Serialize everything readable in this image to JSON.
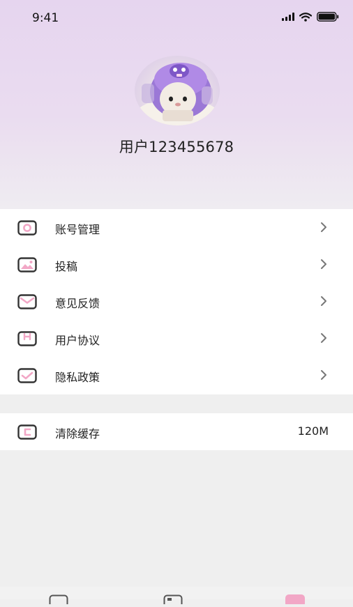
{
  "status_bar": {
    "time": "9:41"
  },
  "profile": {
    "username": "用户123455678"
  },
  "menu": {
    "items": [
      {
        "label": "账号管理",
        "icon": "account-icon"
      },
      {
        "label": "投稿",
        "icon": "image-icon"
      },
      {
        "label": "意见反馈",
        "icon": "envelope-icon"
      },
      {
        "label": "用户协议",
        "icon": "agreement-icon"
      },
      {
        "label": "隐私政策",
        "icon": "check-icon"
      }
    ]
  },
  "cache": {
    "label": "清除缓存",
    "value": "120M",
    "icon": "clear-cache-icon"
  },
  "tabbar": {
    "tabs": [
      {
        "icon": "home-icon"
      },
      {
        "icon": "category-icon"
      },
      {
        "icon": "profile-icon"
      }
    ]
  },
  "colors": {
    "accent_pink": "#f2a7c6",
    "header_lavender": "#e6d5ef"
  }
}
